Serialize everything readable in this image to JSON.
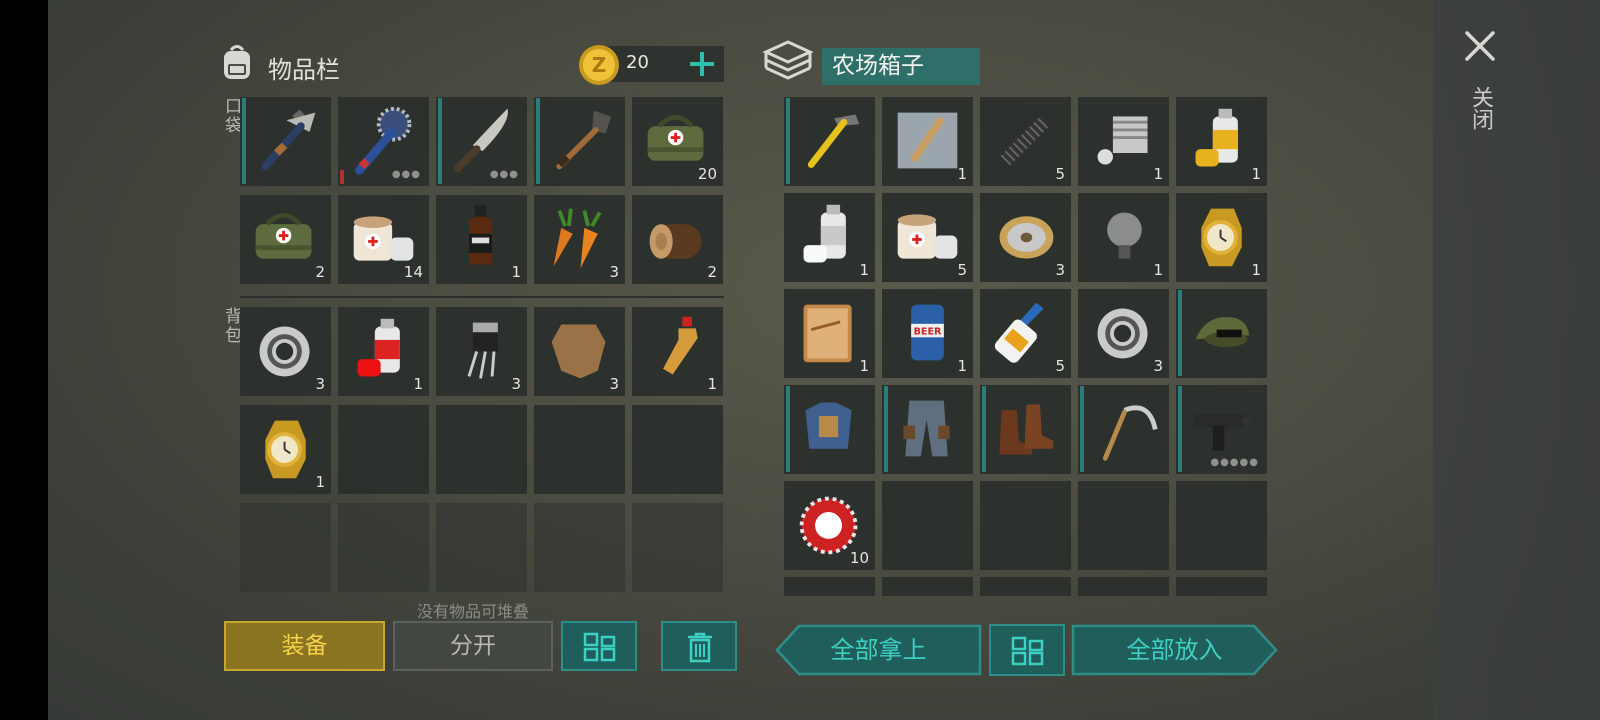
{
  "left": {
    "title": "物品栏",
    "coins": "20",
    "pockets_label": "口袋",
    "backpack_label": "背包",
    "pockets": [
      {
        "icon": "hammer-axe-icon",
        "count": "",
        "cond": "teal"
      },
      {
        "icon": "saw-blade-mace-icon",
        "count": "",
        "cond": "red",
        "dots": "●●●"
      },
      {
        "icon": "machete-icon",
        "count": "",
        "cond": "teal",
        "dots": "●●●"
      },
      {
        "icon": "shovel-icon",
        "count": "",
        "cond": "teal"
      },
      {
        "icon": "medkit-bag-icon",
        "count": "20"
      },
      {
        "icon": "medkit-bag-icon",
        "count": "2"
      },
      {
        "icon": "bandage-icon",
        "count": "14"
      },
      {
        "icon": "whiskey-bottle-icon",
        "count": "1"
      },
      {
        "icon": "carrot-icon",
        "count": "3"
      },
      {
        "icon": "wood-log-icon",
        "count": "2"
      }
    ],
    "backpack": [
      {
        "icon": "bearing-icon",
        "count": "3"
      },
      {
        "icon": "spray-paint-red-icon",
        "count": "1"
      },
      {
        "icon": "transistor-icon",
        "count": "3"
      },
      {
        "icon": "animal-hide-icon",
        "count": "3"
      },
      {
        "icon": "soda-bottle-icon",
        "count": "1"
      },
      {
        "icon": "gold-watch-icon",
        "count": "1"
      }
    ],
    "hint": "没有物品可堆叠",
    "equip_label": "装备",
    "split_label": "分开"
  },
  "right": {
    "title": "农场箱子",
    "items": [
      {
        "icon": "claw-hammer-icon",
        "count": "",
        "cond": "teal"
      },
      {
        "icon": "blueprint-icon",
        "count": "1"
      },
      {
        "icon": "spring-icon",
        "count": "5"
      },
      {
        "icon": "engine-cylinder-icon",
        "count": "1"
      },
      {
        "icon": "spray-paint-yellow-icon",
        "count": "1"
      },
      {
        "icon": "spray-paint-white-icon",
        "count": "1"
      },
      {
        "icon": "bandage-icon",
        "count": "5"
      },
      {
        "icon": "wire-spool-icon",
        "count": "3"
      },
      {
        "icon": "light-bulb-icon",
        "count": "1"
      },
      {
        "icon": "gold-watch-icon",
        "count": "1"
      },
      {
        "icon": "diary-icon",
        "count": "1"
      },
      {
        "icon": "beer-can-icon",
        "count": "1"
      },
      {
        "icon": "glue-bottle-icon",
        "count": "5"
      },
      {
        "icon": "bearing-icon",
        "count": "3"
      },
      {
        "icon": "camo-cap-icon",
        "count": "",
        "cond": "teal"
      },
      {
        "icon": "tactical-vest-icon",
        "count": "",
        "cond": "teal"
      },
      {
        "icon": "cargo-pants-icon",
        "count": "",
        "cond": "teal"
      },
      {
        "icon": "leather-boots-icon",
        "count": "",
        "cond": "teal"
      },
      {
        "icon": "sickle-icon",
        "count": "",
        "cond": "teal"
      },
      {
        "icon": "uzi-gun-icon",
        "count": "",
        "cond": "teal",
        "dots": "●●●●●"
      },
      {
        "icon": "bottle-cap-icon",
        "count": "10"
      }
    ],
    "take_all_label": "全部拿上",
    "put_all_label": "全部放入"
  },
  "close_label": "关闭",
  "colors": {
    "teal": "#2f8f88",
    "gold": "#c9a72e",
    "slot": "#2d312e"
  }
}
